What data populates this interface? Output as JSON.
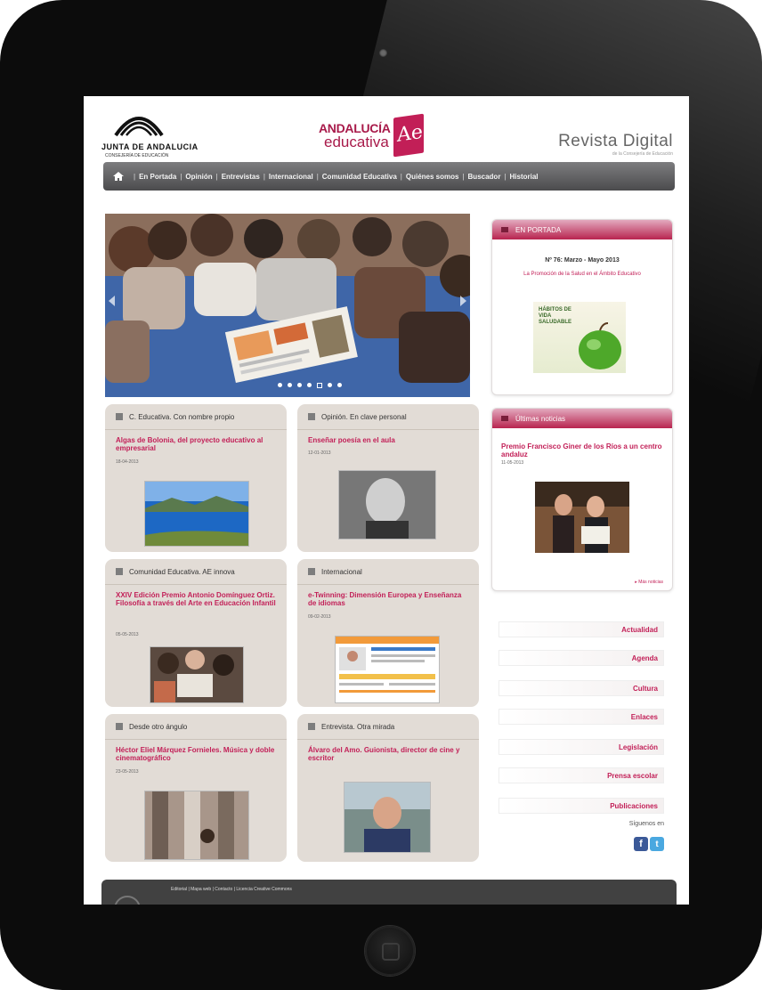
{
  "header": {
    "junta_name": "JUNTA DE ANDALUCIA",
    "junta_sub": "CONSEJERÍA DE EDUCACIÓN",
    "ae_line1": "ANDALUCÍA",
    "ae_line2": "educativa",
    "ae_mark": "Ae",
    "title": "Revista Digital",
    "subtitle": "de la Consejería de Educación"
  },
  "nav": {
    "items": [
      "En Portada",
      "Opinión",
      "Entrevistas",
      "Internacional",
      "Comunidad Educativa",
      "Quiénes somos",
      "Buscador",
      "Historial"
    ]
  },
  "slider": {
    "dot_count": 7,
    "active_dot": 5
  },
  "tiles": [
    {
      "label": "C. Educativa. Con nombre propio",
      "title": "Algas de Bolonia, del proyecto educativo al empresarial",
      "date": "18-04-2013"
    },
    {
      "label": "Opinión. En clave personal",
      "title": "Enseñar poesía en el aula",
      "date": "12-01-2013"
    },
    {
      "label": "Comunidad Educativa. AE innova",
      "title": "XXIV Edición Premio Antonio Domínguez Ortiz. Filosofía a través del Arte en Educación Infantil",
      "date": "05-05-2013"
    },
    {
      "label": "Internacional",
      "title": "e-Twinning: Dimensión Europea y Enseñanza de idiomas",
      "date": "09-02-2013"
    },
    {
      "label": "Desde otro ángulo",
      "title": "Héctor Eliel Márquez Fornieles. Música y doble cinematográfico",
      "date": "23-05-2013"
    },
    {
      "label": "Entrevista. Otra mirada",
      "title": "Álvaro del Amo. Guionista, director de cine y escritor",
      "date": ""
    }
  ],
  "portada": {
    "head": "EN PORTADA",
    "issue": "Nº 76: Marzo - Mayo 2013",
    "headline": "La Promoción de la Salud en el Ámbito Educativo",
    "cover_text": "HÁBITOS DE VIDA SALUDABLE"
  },
  "noticias": {
    "head": "Últimas noticias",
    "title": "Premio Francisco Giner de los Ríos a un centro andaluz",
    "date": "11-05-2013",
    "more": "Más noticias"
  },
  "side_links": [
    "Actualidad",
    "Agenda",
    "Cultura",
    "Enlaces",
    "Legislación",
    "Prensa escolar",
    "Publicaciones"
  ],
  "social": {
    "label": "Síguenos en"
  },
  "footer": {
    "links": "Editorial   |   Mapa web   |   Contacto   |   Licencia Creative Commons"
  },
  "colors": {
    "accent": "#c21f57",
    "nav_bg": "#5e5e60",
    "tile_bg": "#e2dcd6",
    "frame": "#0c0c0c"
  }
}
